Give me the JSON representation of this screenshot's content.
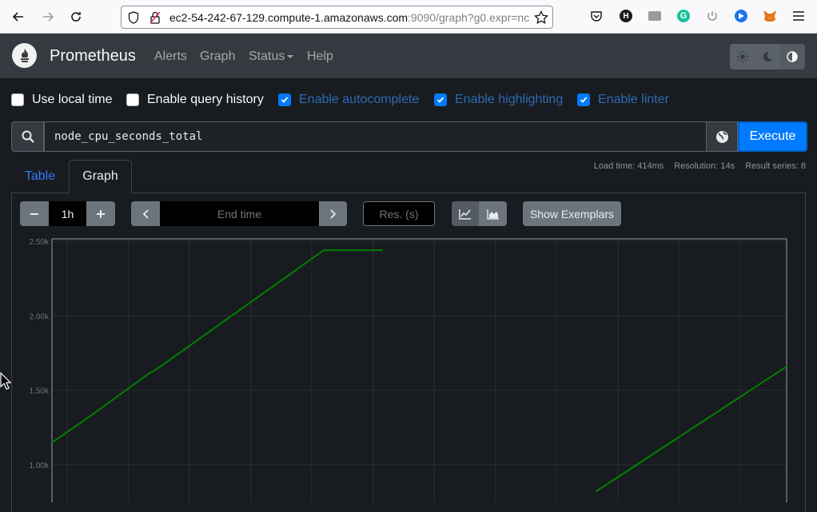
{
  "browser": {
    "url_host": "ec2-54-242-67-129.compute-1.amazonaws.com",
    "url_rest": ":9090/graph?g0.expr=nc"
  },
  "nav": {
    "brand": "Prometheus",
    "links": [
      "Alerts",
      "Graph",
      "Status",
      "Help"
    ]
  },
  "options": [
    {
      "label": "Use local time",
      "checked": false
    },
    {
      "label": "Enable query history",
      "checked": false
    },
    {
      "label": "Enable autocomplete",
      "checked": true
    },
    {
      "label": "Enable highlighting",
      "checked": true
    },
    {
      "label": "Enable linter",
      "checked": true
    }
  ],
  "query": {
    "expression": "node_cpu_seconds_total",
    "execute_label": "Execute"
  },
  "tabs": {
    "table": "Table",
    "graph": "Graph"
  },
  "stats": {
    "load_time": "Load time: 414ms",
    "resolution": "Resolution: 14s",
    "result_series": "Result series: 8"
  },
  "controls": {
    "range": "1h",
    "end_time_placeholder": "End time",
    "resolution_placeholder": "Res. (s)",
    "exemplars_label": "Show Exemplars"
  },
  "chart_data": {
    "type": "line",
    "ytick_labels": [
      "2.50k",
      "2.00k",
      "1.50k",
      "1.00k"
    ],
    "yticks": [
      2500,
      2000,
      1500,
      1000
    ],
    "series_color": "#008000",
    "grid": true,
    "series": [
      {
        "points": [
          [
            0,
            1150
          ],
          [
            0.05,
            1320
          ],
          [
            0.134,
            1620
          ],
          [
            0.142,
            1640
          ],
          [
            0.37,
            2440
          ],
          [
            0.45,
            2440
          ]
        ]
      },
      {
        "points": [
          [
            0.74,
            820
          ],
          [
            1.0,
            1660
          ]
        ]
      }
    ]
  },
  "colors": {
    "accent": "#007bff",
    "navbar": "#343a40",
    "background": "#181b1f"
  }
}
